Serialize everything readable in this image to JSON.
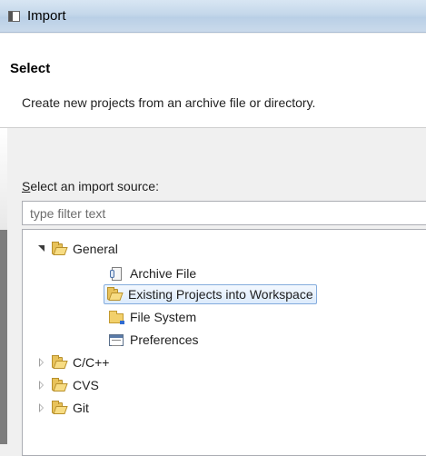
{
  "window": {
    "title": "Import"
  },
  "header": {
    "title": "Select",
    "description": "Create new projects from an archive file or directory."
  },
  "source": {
    "label_accel": "S",
    "label_rest": "elect an import source:",
    "filter_placeholder": "type filter text"
  },
  "tree": {
    "items": [
      {
        "label": "General",
        "level": 0,
        "expanded": true,
        "icon": "folder-open-icon"
      },
      {
        "label": "Archive File",
        "level": 1,
        "icon": "archive-file-icon"
      },
      {
        "label": "Existing Projects into Workspace",
        "level": 1,
        "icon": "projects-folder-icon",
        "selected": true
      },
      {
        "label": "File System",
        "level": 1,
        "icon": "folder-icon"
      },
      {
        "label": "Preferences",
        "level": 1,
        "icon": "preferences-icon"
      },
      {
        "label": "C/C++",
        "level": 0,
        "expanded": false,
        "icon": "folder-open-icon"
      },
      {
        "label": "CVS",
        "level": 0,
        "expanded": false,
        "icon": "folder-open-icon"
      },
      {
        "label": "Git",
        "level": 0,
        "expanded": false,
        "icon": "folder-open-icon"
      }
    ]
  },
  "colors": {
    "selection_border": "#84acdd",
    "header_bg": "#ffffff",
    "dialog_bg": "#f0f0f0"
  }
}
